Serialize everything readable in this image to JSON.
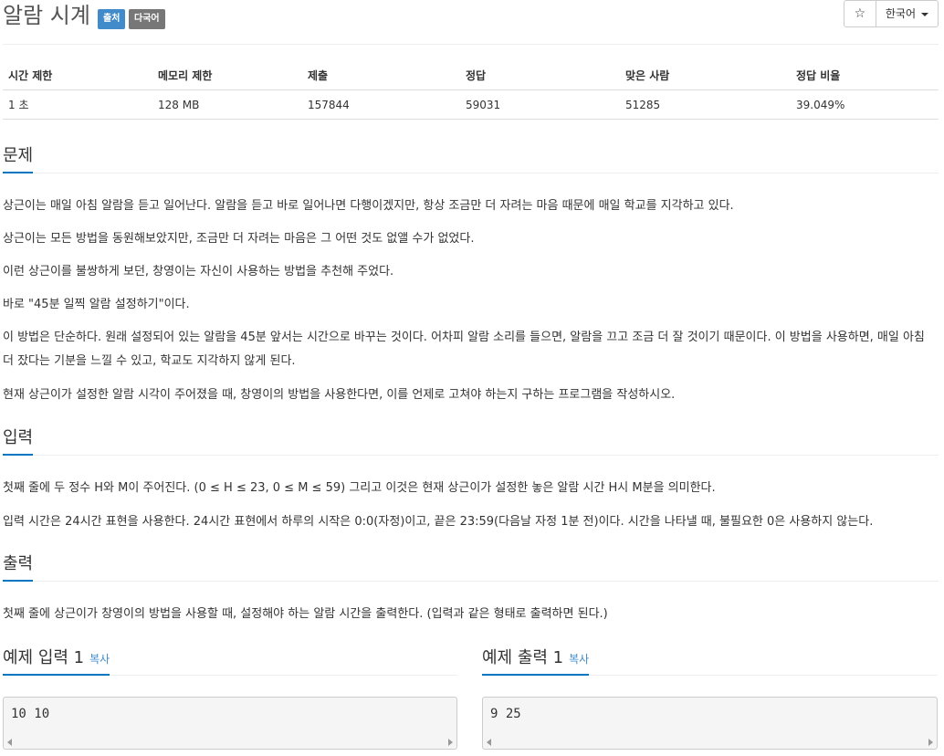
{
  "problem": {
    "title": "알람 시계",
    "badges": {
      "source": "출처",
      "multilang": "다국어"
    }
  },
  "toolbar": {
    "star": "☆",
    "language": "한국어"
  },
  "info_table": {
    "headers": [
      "시간 제한",
      "메모리 제한",
      "제출",
      "정답",
      "맞은 사람",
      "정답 비율"
    ],
    "values": [
      "1 초",
      "128 MB",
      "157844",
      "59031",
      "51285",
      "39.049%"
    ]
  },
  "sections": {
    "problem": {
      "title": "문제",
      "paragraphs": [
        "상근이는 매일 아침 알람을 듣고 일어난다. 알람을 듣고 바로 일어나면 다행이겠지만, 항상 조금만 더 자려는 마음 때문에 매일 학교를 지각하고 있다.",
        "상근이는 모든 방법을 동원해보았지만, 조금만 더 자려는 마음은 그 어떤 것도 없앨 수가 없었다.",
        "이런 상근이를 불쌍하게 보던, 창영이는 자신이 사용하는 방법을 추천해 주었다.",
        "바로 \"45분 일찍 알람 설정하기\"이다.",
        "이 방법은 단순하다. 원래 설정되어 있는 알람을 45분 앞서는 시간으로 바꾸는 것이다. 어차피 알람 소리를 들으면, 알람을 끄고 조금 더 잘 것이기 때문이다. 이 방법을 사용하면, 매일 아침 더 잤다는 기분을 느낄 수 있고, 학교도 지각하지 않게 된다.",
        "현재 상근이가 설정한 알람 시각이 주어졌을 때, 창영이의 방법을 사용한다면, 이를 언제로 고쳐야 하는지 구하는 프로그램을 작성하시오."
      ]
    },
    "input": {
      "title": "입력",
      "paragraphs": [
        "첫째 줄에 두 정수 H와 M이 주어진다. (0 ≤ H ≤ 23, 0 ≤ M ≤ 59) 그리고 이것은 현재 상근이가 설정한 놓은 알람 시간 H시 M분을 의미한다.",
        "입력 시간은 24시간 표현을 사용한다. 24시간 표현에서 하루의 시작은 0:0(자정)이고, 끝은 23:59(다음날 자정 1분 전)이다. 시간을 나타낼 때, 불필요한 0은 사용하지 않는다."
      ]
    },
    "output": {
      "title": "출력",
      "paragraphs": [
        "첫째 줄에 상근이가 창영이의 방법을 사용할 때, 설정해야 하는 알람 시간을 출력한다. (입력과 같은 형태로 출력하면 된다.)"
      ]
    }
  },
  "samples": {
    "input": {
      "title": "예제 입력 1",
      "copy": "복사",
      "content": "10 10"
    },
    "output": {
      "title": "예제 출력 1",
      "copy": "복사",
      "content": "9 25"
    }
  },
  "colors": {
    "accent": "#0076c0",
    "badge_source": "#428bca",
    "badge_multilang": "#777777",
    "link": "#428bca"
  }
}
